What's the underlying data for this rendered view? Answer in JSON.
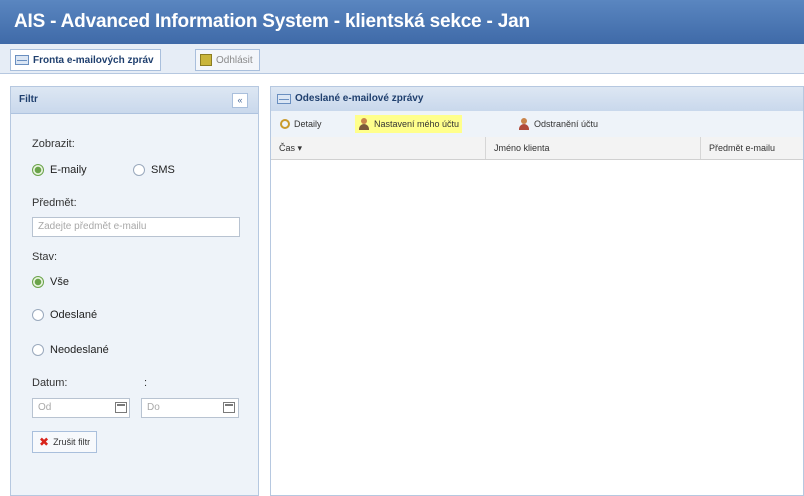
{
  "window": {
    "title": "AIS - Advanced Information System - klientská sekce - Jan"
  },
  "tabs": [
    {
      "label": "Fronta e-mailových zpráv",
      "icon": "mail-icon",
      "active": true
    },
    {
      "label": "Odhlásit",
      "icon": "logout-icon",
      "active": false
    }
  ],
  "filter": {
    "title": "Filtr",
    "collapse_label": "«",
    "show_label": "Zobrazit:",
    "show_options": [
      {
        "label": "E-maily",
        "checked": true
      },
      {
        "label": "SMS",
        "checked": false
      }
    ],
    "subject_label": "Předmět:",
    "subject_placeholder": "Zadejte předmět e-mailu",
    "status_label": "Stav:",
    "status_options": [
      {
        "label": "Vše",
        "checked": true
      },
      {
        "label": "Odeslané",
        "checked": false
      },
      {
        "label": "Neodeslané",
        "checked": false
      }
    ],
    "date_label": "Datum:",
    "date_sep": ":",
    "date_from_placeholder": "Od",
    "date_to_placeholder": "Do",
    "clear_button": "Zrušit filtr"
  },
  "main": {
    "title": "Odeslané e-mailové zprávy",
    "toolbar": [
      {
        "label": "Detaily",
        "icon": "magnifier-icon",
        "highlighted": false
      },
      {
        "label": "Nastavení mého účtu",
        "icon": "user-settings-icon",
        "highlighted": true
      },
      {
        "label": "Odstranění účtu",
        "icon": "user-remove-icon",
        "highlighted": false
      }
    ],
    "columns": [
      "Čas ▾",
      "Jméno klienta",
      "Předmět e-mailu"
    ]
  }
}
